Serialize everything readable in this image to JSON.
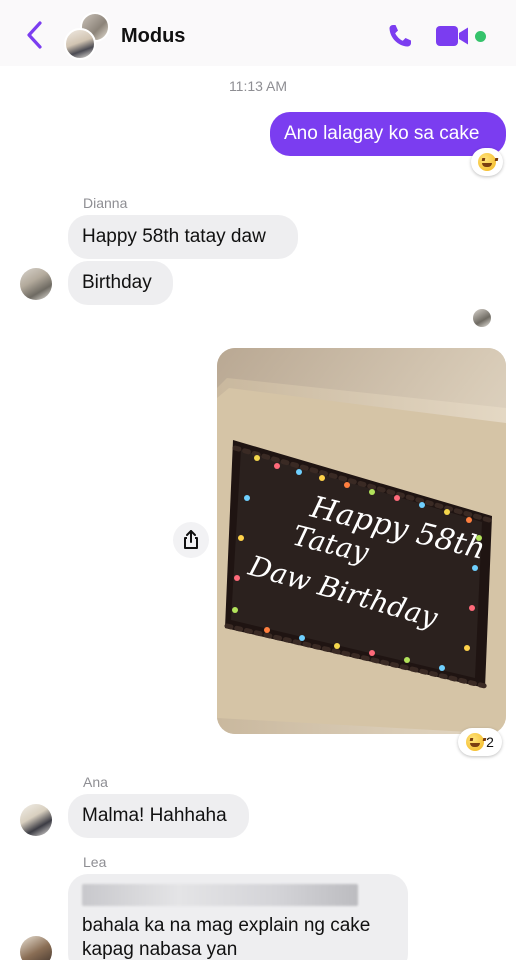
{
  "header": {
    "title": "Modus",
    "icons": {
      "back": "chevron-left-icon",
      "call": "phone-icon",
      "video": "video-camera-icon"
    },
    "accent": "#7b3df0",
    "online_color": "#35c36b"
  },
  "thread": {
    "timestamp": "11:13 AM",
    "outgoing_1": {
      "text": "Ano lalagay ko sa cake",
      "reaction": "grinning-squinting-face"
    },
    "dianna": {
      "sender": "Dianna",
      "messages": [
        "Happy 58th tatay daw",
        "Birthday"
      ]
    },
    "photo": {
      "cake_text": [
        "Happy 58th",
        "Tatay",
        "Daw Birthday"
      ],
      "reaction": "grinning-squinting-face",
      "reaction_count": "2"
    },
    "ana": {
      "sender": "Ana",
      "message": "Malma! Hahhaha"
    },
    "lea": {
      "sender": "Lea",
      "message_lines": [
        "bahala ka na mag explain ng cake",
        "kapag nabasa yan"
      ]
    }
  }
}
